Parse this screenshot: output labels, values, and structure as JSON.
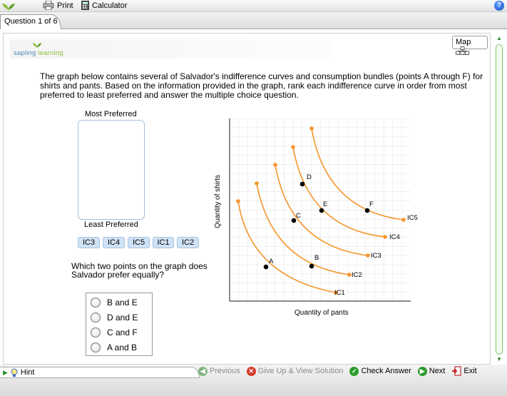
{
  "toolbar": {
    "print_label": "Print",
    "calculator_label": "Calculator",
    "help_label": "?"
  },
  "tab": {
    "label": "Question 1 of 6"
  },
  "brand": {
    "part1": "sapling",
    "part2": "learning"
  },
  "map_button": {
    "label": "Map"
  },
  "question": {
    "text": "The graph below contains several of Salvador's indifference curves and consumption bundles (points A through F) for shirts and pants. Based on the information provided in the graph, rank each indifference curve in order from most preferred to least preferred and answer the multiple choice question."
  },
  "ranking": {
    "most_label": "Most Preferred",
    "least_label": "Least Preferred",
    "chips": [
      "IC3",
      "IC4",
      "IC5",
      "IC1",
      "IC2"
    ]
  },
  "mcq": {
    "text": "Which two points on the graph does Salvador prefer equally?",
    "options": [
      "B and E",
      "D and E",
      "C and F",
      "A and B"
    ]
  },
  "graph": {
    "xlabel": "Quantity of pants",
    "ylabel": "Quantity of shirts",
    "curve_labels": [
      "IC1",
      "IC2",
      "IC3",
      "IC4",
      "IC5"
    ],
    "point_labels": [
      "A",
      "B",
      "C",
      "D",
      "E",
      "F"
    ],
    "curve_color": "#f5962c",
    "point_color": "#000000"
  },
  "nav": {
    "previous": "Previous",
    "giveup": "Give Up & View Solution",
    "check": "Check Answer",
    "next": "Next",
    "exit": "Exit",
    "hint": "Hint"
  }
}
